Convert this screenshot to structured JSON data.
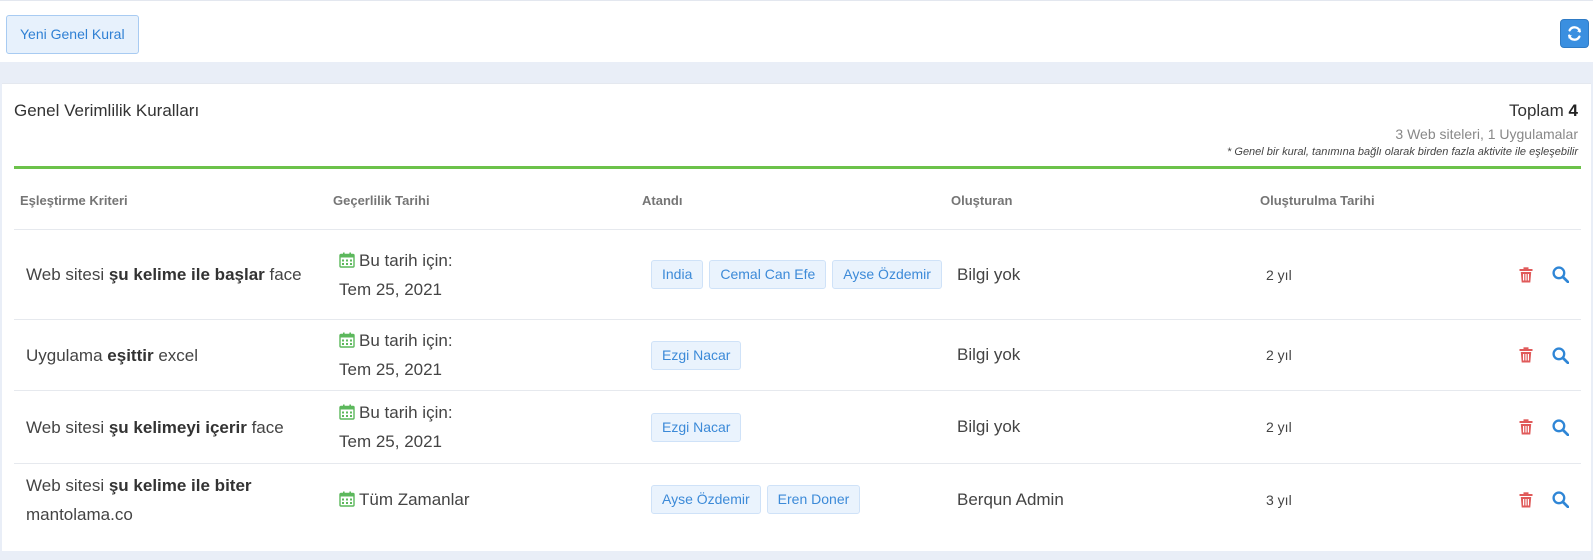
{
  "toolbar": {
    "new_rule_label": "Yeni Genel Kural"
  },
  "card": {
    "title": "Genel Verimlilik Kuralları",
    "total_label": "Toplam",
    "total_count": "4",
    "subtotal": "3 Web siteleri, 1 Uygulamalar",
    "note": "* Genel bir kural, tanımına bağlı olarak birden fazla aktivite ile eşleşebilir"
  },
  "table": {
    "headers": [
      "Eşleştirme Kriteri",
      "Geçerlilik Tarihi",
      "Atandı",
      "Oluşturan",
      "Oluşturulma Tarihi"
    ],
    "rows": [
      {
        "crit_type": "Web sitesi",
        "crit_op": "şu kelime ile başlar",
        "crit_val": "face",
        "validity_label": "Bu tarih için:",
        "validity_date": "Tem 25, 2021",
        "assigned": [
          "India",
          "Cemal Can Efe",
          "Ayse Özdemir"
        ],
        "creator": "Bilgi yok",
        "created": "2 yıl"
      },
      {
        "crit_type": "Uygulama",
        "crit_op": "eşittir",
        "crit_val": "excel",
        "validity_label": "Bu tarih için:",
        "validity_date": "Tem 25, 2021",
        "assigned": [
          "Ezgi Nacar"
        ],
        "creator": "Bilgi yok",
        "created": "2 yıl"
      },
      {
        "crit_type": "Web sitesi",
        "crit_op": "şu kelimeyi içerir",
        "crit_val": "face",
        "validity_label": "Bu tarih için:",
        "validity_date": "Tem 25, 2021",
        "assigned": [
          "Ezgi Nacar"
        ],
        "creator": "Bilgi yok",
        "created": "2 yıl"
      },
      {
        "crit_type": "Web sitesi",
        "crit_op": "şu kelime ile biter",
        "crit_val": "mantolama.co",
        "validity_label": "Tüm Zamanlar",
        "validity_date": "",
        "assigned": [
          "Ayse Özdemir",
          "Eren Doner"
        ],
        "creator": "Berqun Admin",
        "created": "3 yıl"
      }
    ]
  },
  "icons": {
    "refresh": "refresh-icon",
    "calendar": "calendar-icon",
    "delete": "trash-icon",
    "view": "search-icon"
  },
  "colors": {
    "accent": "#3a8fe0",
    "green": "#6cc24a",
    "danger": "#e05a5a",
    "tag_bg": "#eaf3fd"
  }
}
